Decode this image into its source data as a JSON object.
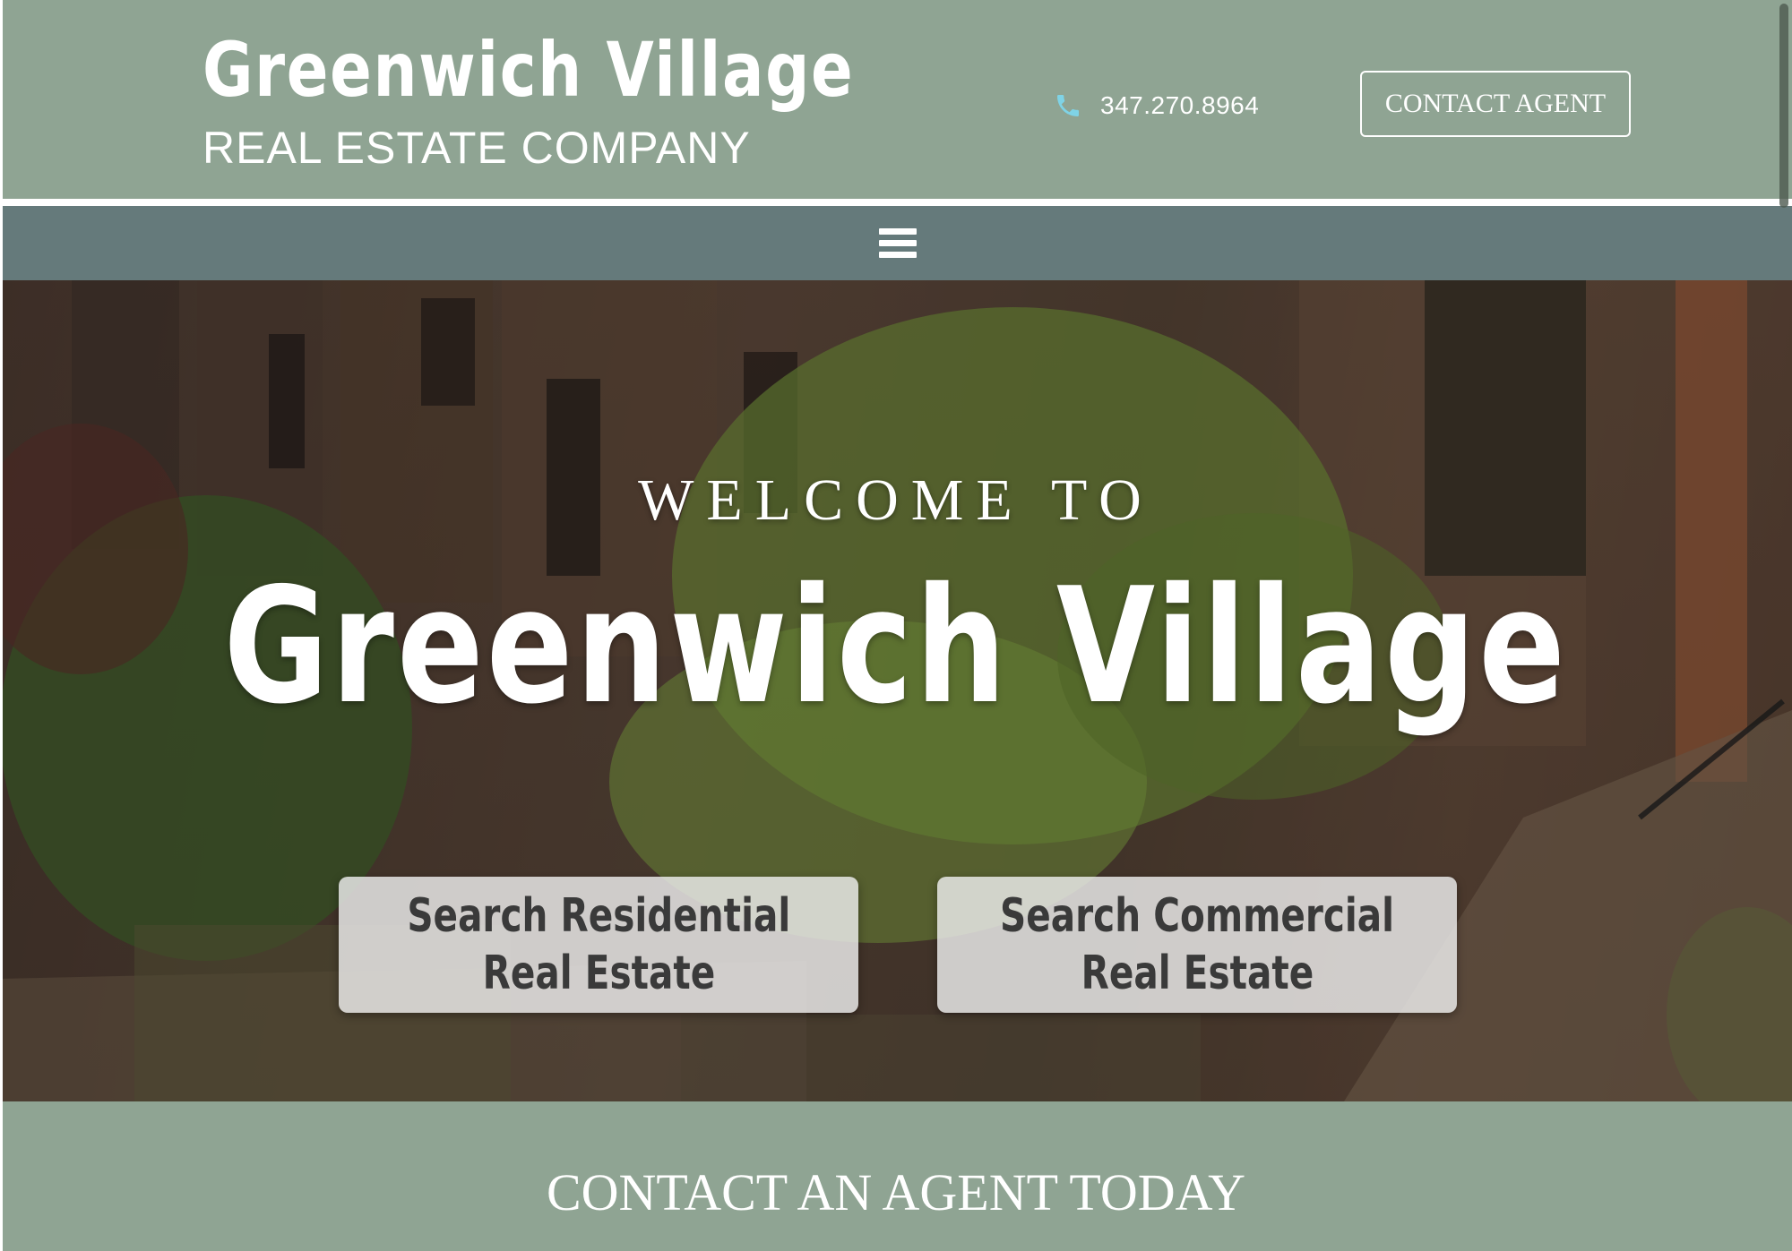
{
  "header": {
    "logo_main": "Greenwich Village",
    "logo_sub": "REAL ESTATE COMPANY",
    "phone": "347.270.8964",
    "contact_button": "CONTACT AGENT"
  },
  "nav": {
    "menu_icon": "hamburger-menu-icon"
  },
  "hero": {
    "welcome": "WELCOME TO",
    "title": "Greenwich Village",
    "buttons": [
      {
        "line1": "Search Residential",
        "line2": "Real Estate"
      },
      {
        "line1": "Search Commercial",
        "line2": "Real Estate"
      }
    ]
  },
  "contact_band": {
    "title": "CONTACT AN AGENT TODAY"
  },
  "colors": {
    "header_bg": "#8fa493",
    "nav_bg": "#657a7b",
    "button_bg": "#eeeeee",
    "button_text": "#3a3a3a",
    "white": "#ffffff"
  }
}
